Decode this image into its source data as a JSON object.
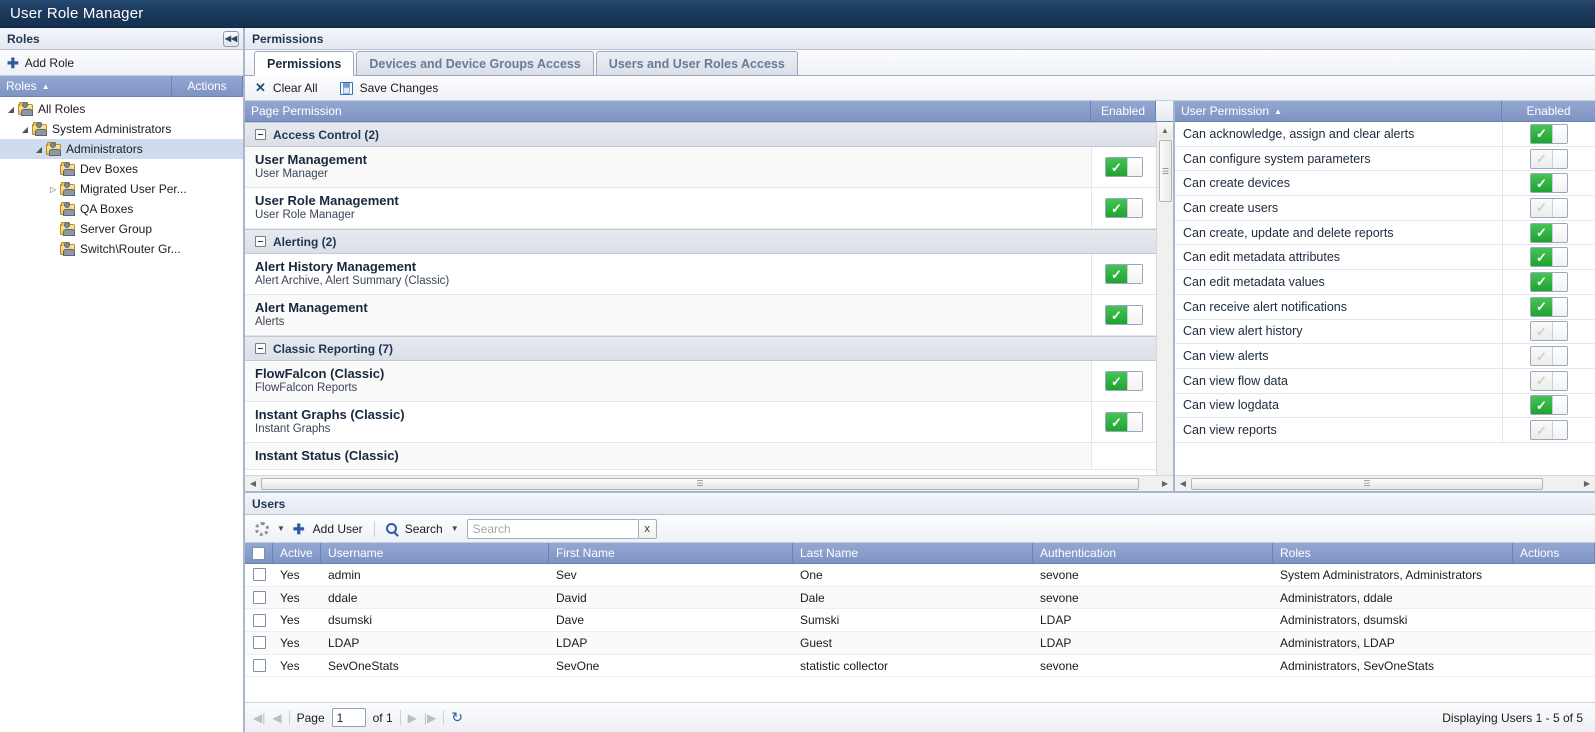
{
  "app": {
    "title": "User Role Manager"
  },
  "roles_panel": {
    "header": "Roles",
    "collapse_icon": "collapse-left-icon",
    "add_role_label": "Add Role",
    "columns": {
      "roles": "Roles",
      "actions": "Actions"
    },
    "sort_indicator": "▲",
    "tree": [
      {
        "label": "All Roles",
        "depth": 0,
        "twisty": "◢",
        "selected": false
      },
      {
        "label": "System Administrators",
        "depth": 1,
        "twisty": "◢",
        "selected": false
      },
      {
        "label": "Administrators",
        "depth": 2,
        "twisty": "◢",
        "selected": true
      },
      {
        "label": "Dev Boxes",
        "depth": 3,
        "twisty": "",
        "selected": false
      },
      {
        "label": "Migrated User Per...",
        "depth": 3,
        "twisty": "▷",
        "selected": false
      },
      {
        "label": "QA Boxes",
        "depth": 3,
        "twisty": "",
        "selected": false
      },
      {
        "label": "Server Group",
        "depth": 3,
        "twisty": "",
        "selected": false
      },
      {
        "label": "Switch\\Router Gr...",
        "depth": 3,
        "twisty": "",
        "selected": false
      }
    ]
  },
  "permissions_panel": {
    "header": "Permissions",
    "tabs": [
      {
        "label": "Permissions",
        "active": true
      },
      {
        "label": "Devices and Device Groups Access",
        "active": false
      },
      {
        "label": "Users and User Roles Access",
        "active": false
      }
    ],
    "toolbar": {
      "clear_all": "Clear All",
      "save_changes": "Save Changes"
    },
    "page_grid": {
      "columns": {
        "page_permission": "Page Permission",
        "enabled": "Enabled"
      },
      "groups": [
        {
          "label": "Access Control (2)",
          "rows": [
            {
              "title": "User Management",
              "sub": "User Manager",
              "enabled": true
            },
            {
              "title": "User Role Management",
              "sub": "User Role Manager",
              "enabled": true
            }
          ]
        },
        {
          "label": "Alerting (2)",
          "rows": [
            {
              "title": "Alert History Management",
              "sub": "Alert Archive, Alert Summary (Classic)",
              "enabled": true
            },
            {
              "title": "Alert Management",
              "sub": "Alerts",
              "enabled": true
            }
          ]
        },
        {
          "label": "Classic Reporting (7)",
          "rows": [
            {
              "title": "FlowFalcon (Classic)",
              "sub": "FlowFalcon Reports",
              "enabled": true
            },
            {
              "title": "Instant Graphs (Classic)",
              "sub": "Instant Graphs",
              "enabled": true
            },
            {
              "title": "Instant Status (Classic)",
              "sub": "",
              "enabled": false
            }
          ]
        }
      ]
    },
    "user_grid": {
      "columns": {
        "user_permission": "User Permission",
        "enabled": "Enabled"
      },
      "sort_indicator": "▲",
      "rows": [
        {
          "label": "Can acknowledge, assign and clear alerts",
          "enabled": true
        },
        {
          "label": "Can configure system parameters",
          "enabled": false
        },
        {
          "label": "Can create devices",
          "enabled": true
        },
        {
          "label": "Can create users",
          "enabled": false
        },
        {
          "label": "Can create, update and delete reports",
          "enabled": true
        },
        {
          "label": "Can edit metadata attributes",
          "enabled": true
        },
        {
          "label": "Can edit metadata values",
          "enabled": true
        },
        {
          "label": "Can receive alert notifications",
          "enabled": true
        },
        {
          "label": "Can view alert history",
          "enabled": false
        },
        {
          "label": "Can view alerts",
          "enabled": false
        },
        {
          "label": "Can view flow data",
          "enabled": false
        },
        {
          "label": "Can view logdata",
          "enabled": true
        },
        {
          "label": "Can view reports",
          "enabled": false
        }
      ]
    }
  },
  "users_panel": {
    "header": "Users",
    "toolbar": {
      "gear_icon": "gear-icon",
      "add_user": "Add User",
      "search_menu": "Search",
      "search_value": "",
      "search_placeholder": "Search",
      "clear_search": "x"
    },
    "columns": [
      "Active",
      "Username",
      "First Name",
      "Last Name",
      "Authentication",
      "Roles",
      "Actions"
    ],
    "rows": [
      {
        "active": "Yes",
        "username": "admin",
        "first": "Sev",
        "last": "One",
        "auth": "sevone",
        "roles": "System Administrators, Administrators"
      },
      {
        "active": "Yes",
        "username": "ddale",
        "first": "David",
        "last": "Dale",
        "auth": "sevone",
        "roles": "Administrators, ddale"
      },
      {
        "active": "Yes",
        "username": "dsumski",
        "first": "Dave",
        "last": "Sumski",
        "auth": "LDAP",
        "roles": "Administrators, dsumski"
      },
      {
        "active": "Yes",
        "username": "LDAP",
        "first": "LDAP",
        "last": "Guest",
        "auth": "LDAP",
        "roles": "Administrators, LDAP"
      },
      {
        "active": "Yes",
        "username": "SevOneStats",
        "first": "SevOne",
        "last": "statistic collector",
        "auth": "sevone",
        "roles": "Administrators, SevOneStats"
      }
    ],
    "footer": {
      "first_icon": "◀|",
      "prev_icon": "◀",
      "page_label": "Page",
      "page_value": "1",
      "of_label": "of 1",
      "next_icon": "▶",
      "last_icon": "|▶",
      "refresh_icon": "refresh-icon",
      "displaying": "Displaying Users 1 - 5 of 5"
    }
  },
  "colors": {
    "titlebar": "#1b3a5c",
    "grid_header": "#7e94c3",
    "selected_row": "#cfdcef",
    "toggle_on": "#25a935"
  }
}
